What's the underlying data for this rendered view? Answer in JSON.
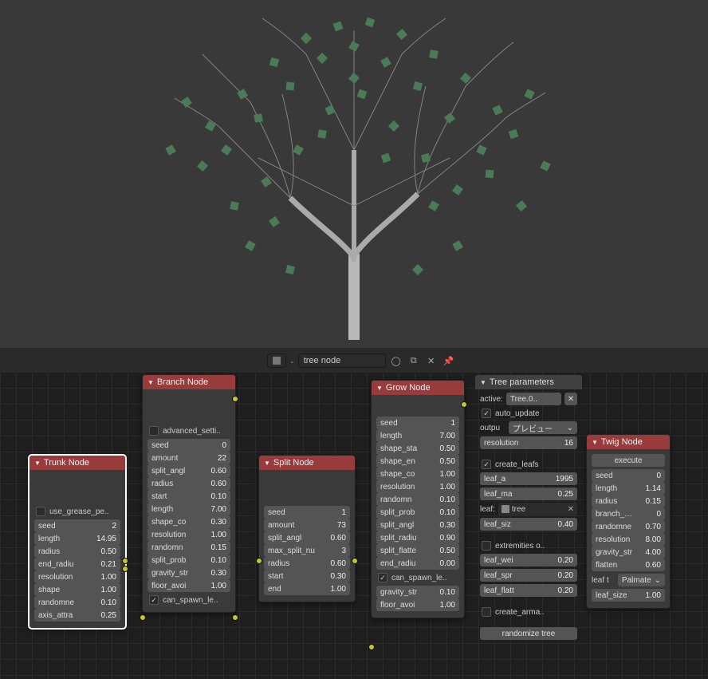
{
  "toolbar": {
    "search": "tree node"
  },
  "nodes": {
    "trunk": {
      "title": "Trunk Node",
      "use_grease": {
        "label": "use_grease_pe..",
        "on": false
      },
      "props": [
        {
          "lbl": "seed",
          "val": "2"
        },
        {
          "lbl": "length",
          "val": "14.95"
        },
        {
          "lbl": "radius",
          "val": "0.50"
        },
        {
          "lbl": "end_radiu",
          "val": "0.21"
        },
        {
          "lbl": "resolution",
          "val": "1.00"
        },
        {
          "lbl": "shape",
          "val": "1.00"
        },
        {
          "lbl": "randomne",
          "val": "0.10"
        },
        {
          "lbl": "axis_attra",
          "val": "0.25"
        }
      ]
    },
    "branch": {
      "title": "Branch Node",
      "adv": {
        "label": "advanced_setti..",
        "on": false
      },
      "props": [
        {
          "lbl": "seed",
          "val": "0"
        },
        {
          "lbl": "amount",
          "val": "22"
        },
        {
          "lbl": "split_angl",
          "val": "0.60"
        },
        {
          "lbl": "radius",
          "val": "0.60"
        },
        {
          "lbl": "start",
          "val": "0.10"
        },
        {
          "lbl": "length",
          "val": "7.00"
        },
        {
          "lbl": "shape_co",
          "val": "0.30"
        },
        {
          "lbl": "resolution",
          "val": "1.00"
        },
        {
          "lbl": "randomn",
          "val": "0.15"
        },
        {
          "lbl": "split_prob",
          "val": "0.10"
        },
        {
          "lbl": "gravity_str",
          "val": "0.30"
        },
        {
          "lbl": "floor_avoi",
          "val": "1.00"
        }
      ],
      "can_spawn": {
        "label": "can_spawn_le..",
        "on": true
      }
    },
    "split": {
      "title": "Split Node",
      "props": [
        {
          "lbl": "seed",
          "val": "1"
        },
        {
          "lbl": "amount",
          "val": "73"
        },
        {
          "lbl": "split_angl",
          "val": "0.60"
        },
        {
          "lbl": "max_split_nu",
          "val": "3"
        },
        {
          "lbl": "radius",
          "val": "0.60"
        },
        {
          "lbl": "start",
          "val": "0.30"
        },
        {
          "lbl": "end",
          "val": "1.00"
        }
      ]
    },
    "grow": {
      "title": "Grow Node",
      "props": [
        {
          "lbl": "seed",
          "val": "1"
        },
        {
          "lbl": "length",
          "val": "7.00"
        },
        {
          "lbl": "shape_sta",
          "val": "0.50"
        },
        {
          "lbl": "shape_en",
          "val": "0.50"
        },
        {
          "lbl": "shape_co",
          "val": "1.00"
        },
        {
          "lbl": "resolution",
          "val": "1.00"
        },
        {
          "lbl": "randomn",
          "val": "0.10"
        },
        {
          "lbl": "split_prob",
          "val": "0.10"
        },
        {
          "lbl": "split_angl",
          "val": "0.30"
        },
        {
          "lbl": "split_radiu",
          "val": "0.90"
        },
        {
          "lbl": "split_flatte",
          "val": "0.50"
        },
        {
          "lbl": "end_radiu",
          "val": "0.00"
        }
      ],
      "can_spawn": {
        "label": "can_spawn_le..",
        "on": true
      },
      "tail": [
        {
          "lbl": "gravity_str",
          "val": "0.10"
        },
        {
          "lbl": "floor_avoi",
          "val": "1.00"
        }
      ]
    },
    "twig": {
      "title": "Twig Node",
      "execute": "execute",
      "props": [
        {
          "lbl": "seed",
          "val": "0"
        },
        {
          "lbl": "length",
          "val": "1.14"
        },
        {
          "lbl": "radius",
          "val": "0.15"
        },
        {
          "lbl": "branch_num",
          "val": "0"
        },
        {
          "lbl": "randomne",
          "val": "0.70"
        },
        {
          "lbl": "resolution",
          "val": "8.00"
        },
        {
          "lbl": "gravity_str",
          "val": "4.00"
        },
        {
          "lbl": "flatten",
          "val": "0.60"
        }
      ],
      "leaf_type": {
        "lbl": "leaf t",
        "val": "Palmate"
      },
      "leaf_size": {
        "lbl": "leaf_size",
        "val": "1.00"
      }
    }
  },
  "panel": {
    "title": "Tree parameters",
    "active": {
      "lbl": "active:",
      "val": "Tree.0.."
    },
    "auto_update": {
      "label": "auto_update",
      "on": true
    },
    "output": {
      "lbl": "outpu",
      "val": "プレビュー"
    },
    "resolution": {
      "lbl": "resolution",
      "val": "16"
    },
    "create_leafs": {
      "label": "create_leafs",
      "on": true
    },
    "leaf_a": {
      "lbl": "leaf_a",
      "val": "1995"
    },
    "leaf_ma": {
      "lbl": "leaf_ma",
      "val": "0.25"
    },
    "leaf_ref": {
      "lbl": "leaf:",
      "val": "tree"
    },
    "leaf_siz": {
      "lbl": "leaf_siz",
      "val": "0.40"
    },
    "extremities": {
      "label": "extremities o..",
      "on": false
    },
    "leaf_wei": {
      "lbl": "leaf_wei",
      "val": "0.20"
    },
    "leaf_spr": {
      "lbl": "leaf_spr",
      "val": "0.20"
    },
    "leaf_flatt": {
      "lbl": "leaf_flatt",
      "val": "0.20"
    },
    "create_arma": {
      "label": "create_arma..",
      "on": false
    },
    "randomize": "randomize tree"
  }
}
